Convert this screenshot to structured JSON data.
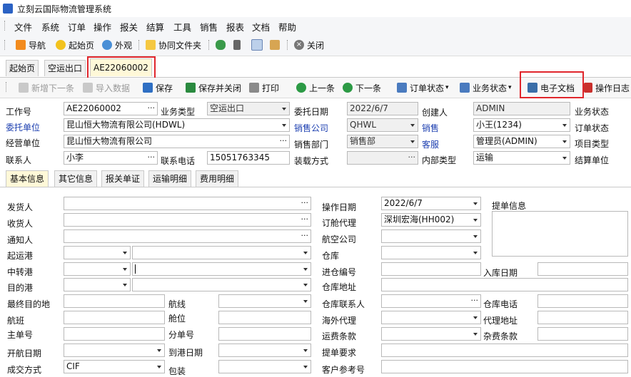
{
  "app": {
    "title": "立刻云国际物流管理系统"
  },
  "menu": [
    "文件",
    "系统",
    "订单",
    "操作",
    "报关",
    "结算",
    "工具",
    "销售",
    "报表",
    "文档",
    "帮助"
  ],
  "toolbar": {
    "nav": "导航",
    "home": "起始页",
    "appearance": "外观",
    "shared_folder": "协同文件夹",
    "close": "关闭"
  },
  "doc_tabs": [
    "起始页",
    "空运出口",
    "AE22060002"
  ],
  "actions": {
    "new_next": "新增下一条",
    "import": "导入数据",
    "save": "保存",
    "save_close": "保存并关闭",
    "print": "打印",
    "prev": "上一条",
    "next": "下一条",
    "order_status": "订单状态",
    "biz_status": "业务状态",
    "e_doc": "电子文档",
    "op_log": "操作日志"
  },
  "header": {
    "job_no": {
      "label": "工作号",
      "value": "AE22060002"
    },
    "biz_type": {
      "label": "业务类型",
      "value": "空运出口"
    },
    "entrust_date": {
      "label": "委托日期",
      "value": "2022/6/7"
    },
    "creator": {
      "label": "创建人",
      "value": "ADMIN"
    },
    "biz_status": {
      "label": "业务状态"
    },
    "client": {
      "label": "委托单位",
      "value": "昆山恒大物流有限公司(HDWL)"
    },
    "sales_company": {
      "label": "销售公司",
      "value": "QHWL"
    },
    "sales": {
      "label": "销售",
      "value": "小王(1234)"
    },
    "order_status": {
      "label": "订单状态"
    },
    "operator": {
      "label": "经营单位",
      "value": "昆山恒大物流有限公司"
    },
    "sales_dept": {
      "label": "销售部门",
      "value": "销售部"
    },
    "cs": {
      "label": "客服",
      "value": "管理员(ADMIN)"
    },
    "project_type": {
      "label": "项目类型"
    },
    "contact": {
      "label": "联系人",
      "value": "小李"
    },
    "phone": {
      "label": "联系电话",
      "value": "15051763345"
    },
    "load_method": {
      "label": "装载方式"
    },
    "inner_type": {
      "label": "内部类型",
      "value": "运输"
    },
    "settle_unit": {
      "label": "结算单位"
    }
  },
  "sub_tabs": [
    "基本信息",
    "其它信息",
    "报关单证",
    "运输明细",
    "费用明细"
  ],
  "basic": {
    "shipper": "发货人",
    "consignee": "收货人",
    "notify": "通知人",
    "pol": "起运港",
    "transit": "中转港",
    "dest_port": "目的港",
    "final_dest": "最终目的地",
    "route": "航线",
    "flight": "航班",
    "space": "舱位",
    "mawb": "主单号",
    "hawb": "分单号",
    "sail_date": "开航日期",
    "arrive_date": "到港日期",
    "trade_terms": {
      "label": "成交方式",
      "value": "CIF"
    },
    "packing": "包装",
    "op_date": {
      "label": "操作日期",
      "value": "2022/6/7"
    },
    "booking_agent": {
      "label": "订舱代理",
      "value": "深圳宏海(HH002)"
    },
    "airline": "航空公司",
    "warehouse": "仓库",
    "entry_no": "进仓编号",
    "entry_date": "入库日期",
    "wh_addr": "仓库地址",
    "wh_contact": "仓库联系人",
    "wh_phone": "仓库电话",
    "overseas_agent": "海外代理",
    "agent_addr": "代理地址",
    "freight_terms": "运费条款",
    "misc_terms": "杂费条款",
    "bl_req": "提单要求",
    "cust_ref": "客户参考号",
    "bl_info": "提单信息"
  }
}
